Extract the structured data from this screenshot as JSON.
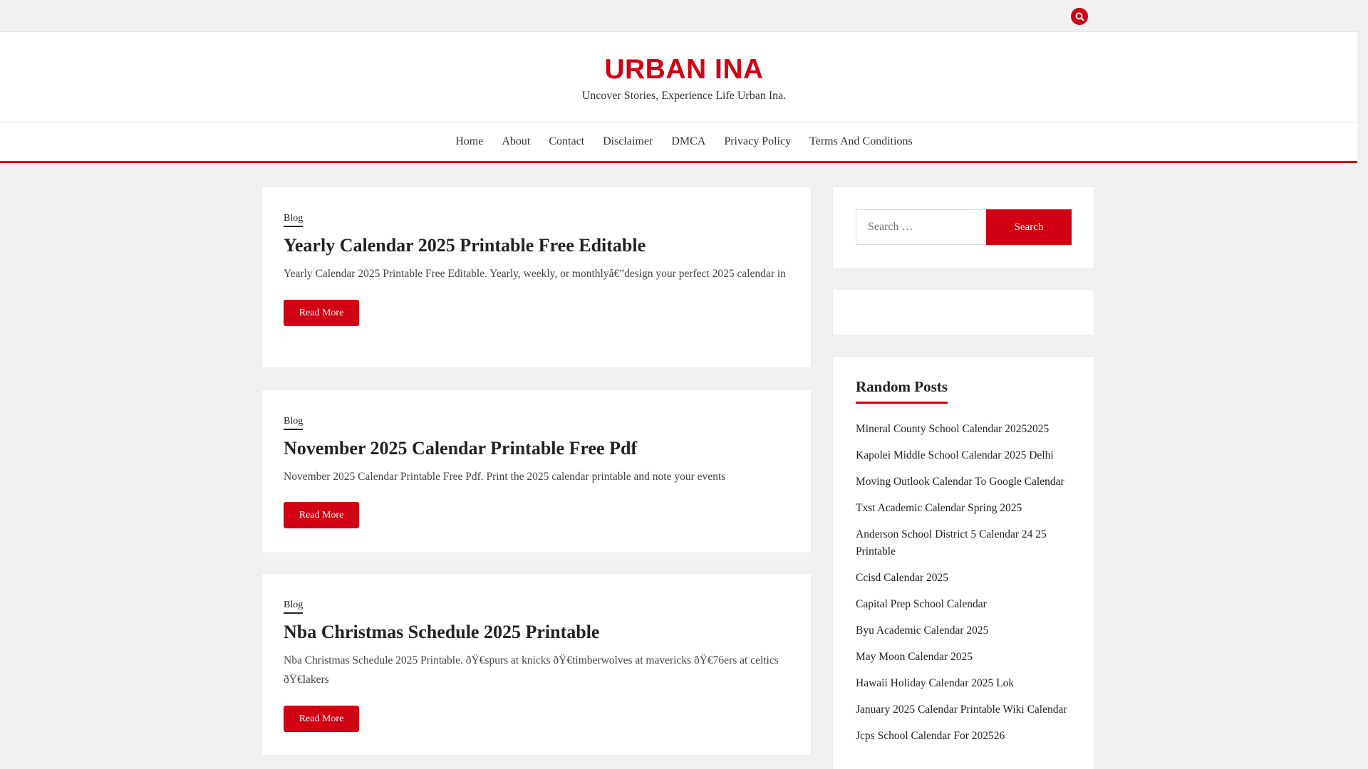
{
  "site": {
    "title": "URBAN INA",
    "tagline": "Uncover Stories, Experience Life Urban Ina."
  },
  "nav": [
    "Home",
    "About",
    "Contact",
    "Disclaimer",
    "DMCA",
    "Privacy Policy",
    "Terms And Conditions"
  ],
  "posts": [
    {
      "category": "Blog",
      "title": "Yearly Calendar 2025 Printable Free Editable",
      "excerpt": "Yearly Calendar 2025 Printable Free Editable. Yearly, weekly, or monthlyâ€”design your perfect 2025 calendar in",
      "read_more": "Read More"
    },
    {
      "category": "Blog",
      "title": "November 2025 Calendar Printable Free Pdf",
      "excerpt": "November 2025 Calendar Printable Free Pdf. Print the 2025 calendar printable and note your events",
      "read_more": "Read More"
    },
    {
      "category": "Blog",
      "title": "Nba Christmas Schedule 2025 Printable",
      "excerpt": "Nba Christmas Schedule 2025 Printable. ðŸ€spurs at knicks ðŸ€timberwolves at mavericks ðŸ€76ers at celtics ðŸ€lakers",
      "read_more": "Read More"
    }
  ],
  "sidebar": {
    "search": {
      "placeholder": "Search …",
      "button": "Search"
    },
    "random_title": "Random Posts",
    "random_posts": [
      "Mineral County School Calendar 20252025",
      "Kapolei Middle School Calendar 2025 Delhi",
      "Moving Outlook Calendar To Google Calendar",
      "Txst Academic Calendar Spring 2025",
      "Anderson School District 5 Calendar 24 25 Printable",
      "Ccisd Calendar 2025",
      "Capital Prep School Calendar",
      "Byu Academic Calendar 2025",
      "May Moon Calendar 2025",
      "Hawaii Holiday Calendar 2025 Lok",
      "January 2025 Calendar Printable Wiki Calendar",
      "Jcps School Calendar For 202526"
    ]
  },
  "colors": {
    "accent": "#d10014"
  }
}
